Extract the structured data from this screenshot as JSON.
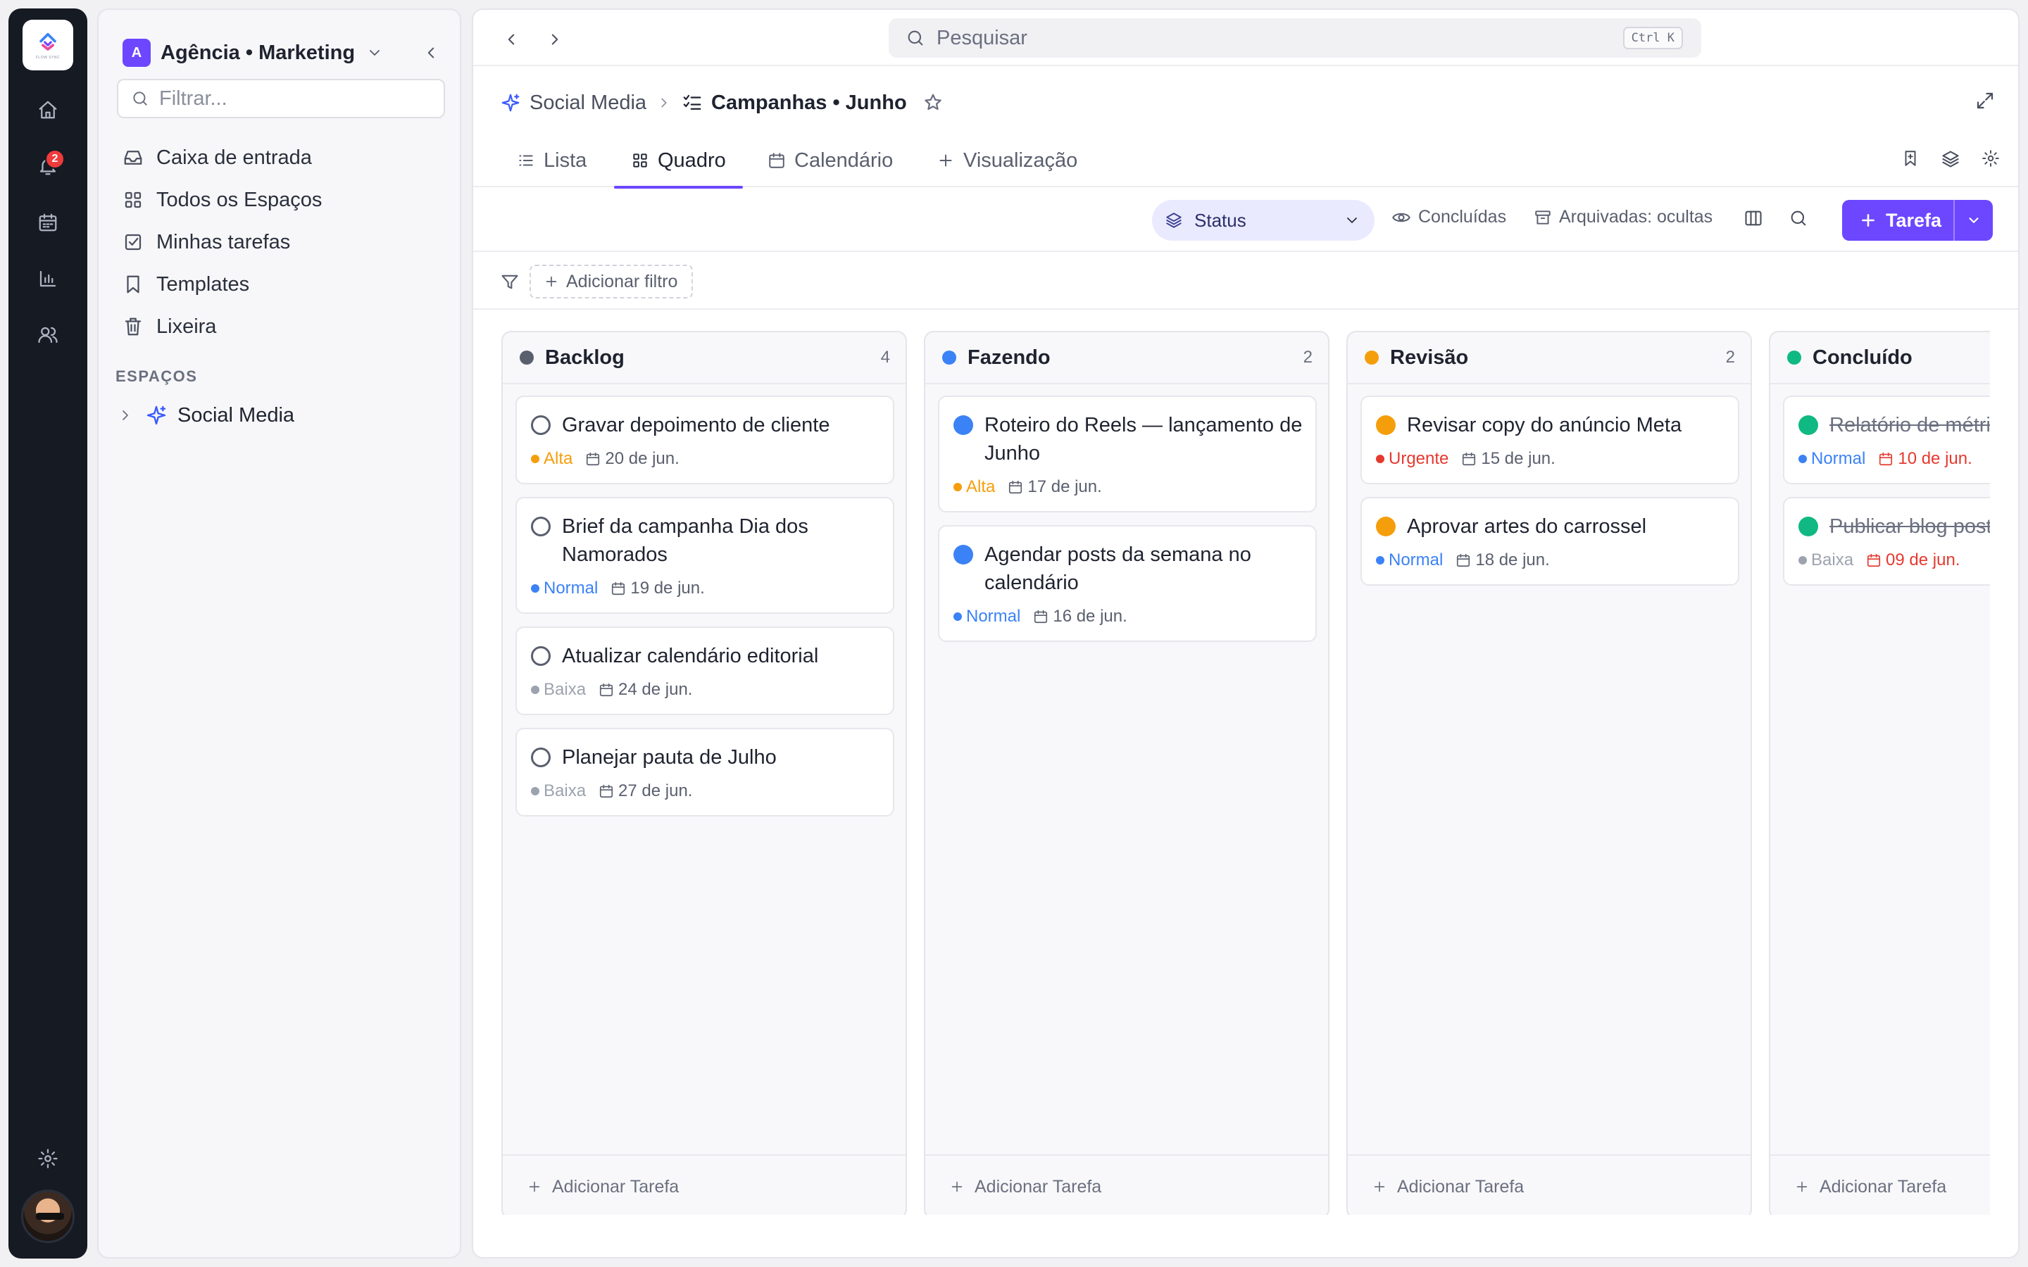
{
  "rail": {
    "logo_text": "FLOW SYNC",
    "notifications_count": "2"
  },
  "sidebar": {
    "workspace_initial": "A",
    "workspace_name": "Agência • Marketing",
    "filter_placeholder": "Filtrar...",
    "nav": [
      {
        "label": "Caixa de entrada",
        "icon": "inbox-icon"
      },
      {
        "label": "Todos os Espaços",
        "icon": "grid-icon"
      },
      {
        "label": "Minhas tarefas",
        "icon": "checkbox-icon"
      },
      {
        "label": "Templates",
        "icon": "bookmark-icon"
      },
      {
        "label": "Lixeira",
        "icon": "trash-icon"
      }
    ],
    "section_label": "ESPAÇOS",
    "spaces": [
      {
        "label": "Social Media",
        "icon": "sparkle-icon"
      }
    ]
  },
  "topbar": {
    "search_placeholder": "Pesquisar",
    "shortcut": "Ctrl K"
  },
  "breadcrumb": {
    "space": "Social Media",
    "list": "Campanhas • Junho"
  },
  "tabs": [
    {
      "label": "Lista",
      "icon": "list-icon"
    },
    {
      "label": "Quadro",
      "icon": "board-icon",
      "active": true
    },
    {
      "label": "Calendário",
      "icon": "calendar-icon"
    },
    {
      "label": "Visualização",
      "icon": "plus-icon"
    }
  ],
  "toolbar": {
    "group_by": "Status",
    "completed": "Concluídas",
    "archived": "Arquivadas: ocultas",
    "new_task": "Tarefa"
  },
  "filterbar": {
    "add_filter": "Adicionar filtro"
  },
  "colors": {
    "accent": "#6c47ff",
    "backlog": "#5a5f6e",
    "doing": "#3b82f6",
    "review": "#f59e0b",
    "done": "#10b981",
    "urgent": "#e5392f",
    "high": "#f59e0b",
    "normal": "#3b82f6",
    "low": "#9ca3af"
  },
  "board": {
    "add_task_label": "Adicionar Tarefa",
    "columns": [
      {
        "title": "Backlog",
        "count": "4",
        "cards": [
          {
            "title": "Gravar depoimento de cliente",
            "priority": "Alta",
            "date": "20 de jun."
          },
          {
            "title": "Brief da campanha Dia dos Namorados",
            "priority": "Normal",
            "date": "19 de jun."
          },
          {
            "title": "Atualizar calendário editorial",
            "priority": "Baixa",
            "date": "24 de jun."
          },
          {
            "title": "Planejar pauta de Julho",
            "priority": "Baixa",
            "date": "27 de jun."
          }
        ]
      },
      {
        "title": "Fazendo",
        "count": "2",
        "cards": [
          {
            "title": "Roteiro do Reels — lançamento de Junho",
            "priority": "Alta",
            "date": "17 de jun."
          },
          {
            "title": "Agendar posts da semana no calendário",
            "priority": "Normal",
            "date": "16 de jun."
          }
        ]
      },
      {
        "title": "Revisão",
        "count": "2",
        "cards": [
          {
            "title": "Revisar copy do anúncio Meta",
            "priority": "Urgente",
            "date": "15 de jun."
          },
          {
            "title": "Aprovar artes do carrossel",
            "priority": "Normal",
            "date": "18 de jun."
          }
        ]
      },
      {
        "title": "Concluído",
        "count": "",
        "cards": [
          {
            "title": "Relatório de métricas de maio",
            "priority": "Normal",
            "date": "10 de jun."
          },
          {
            "title": "Publicar blog post",
            "priority": "Baixa",
            "date": "09 de jun."
          }
        ]
      }
    ]
  }
}
